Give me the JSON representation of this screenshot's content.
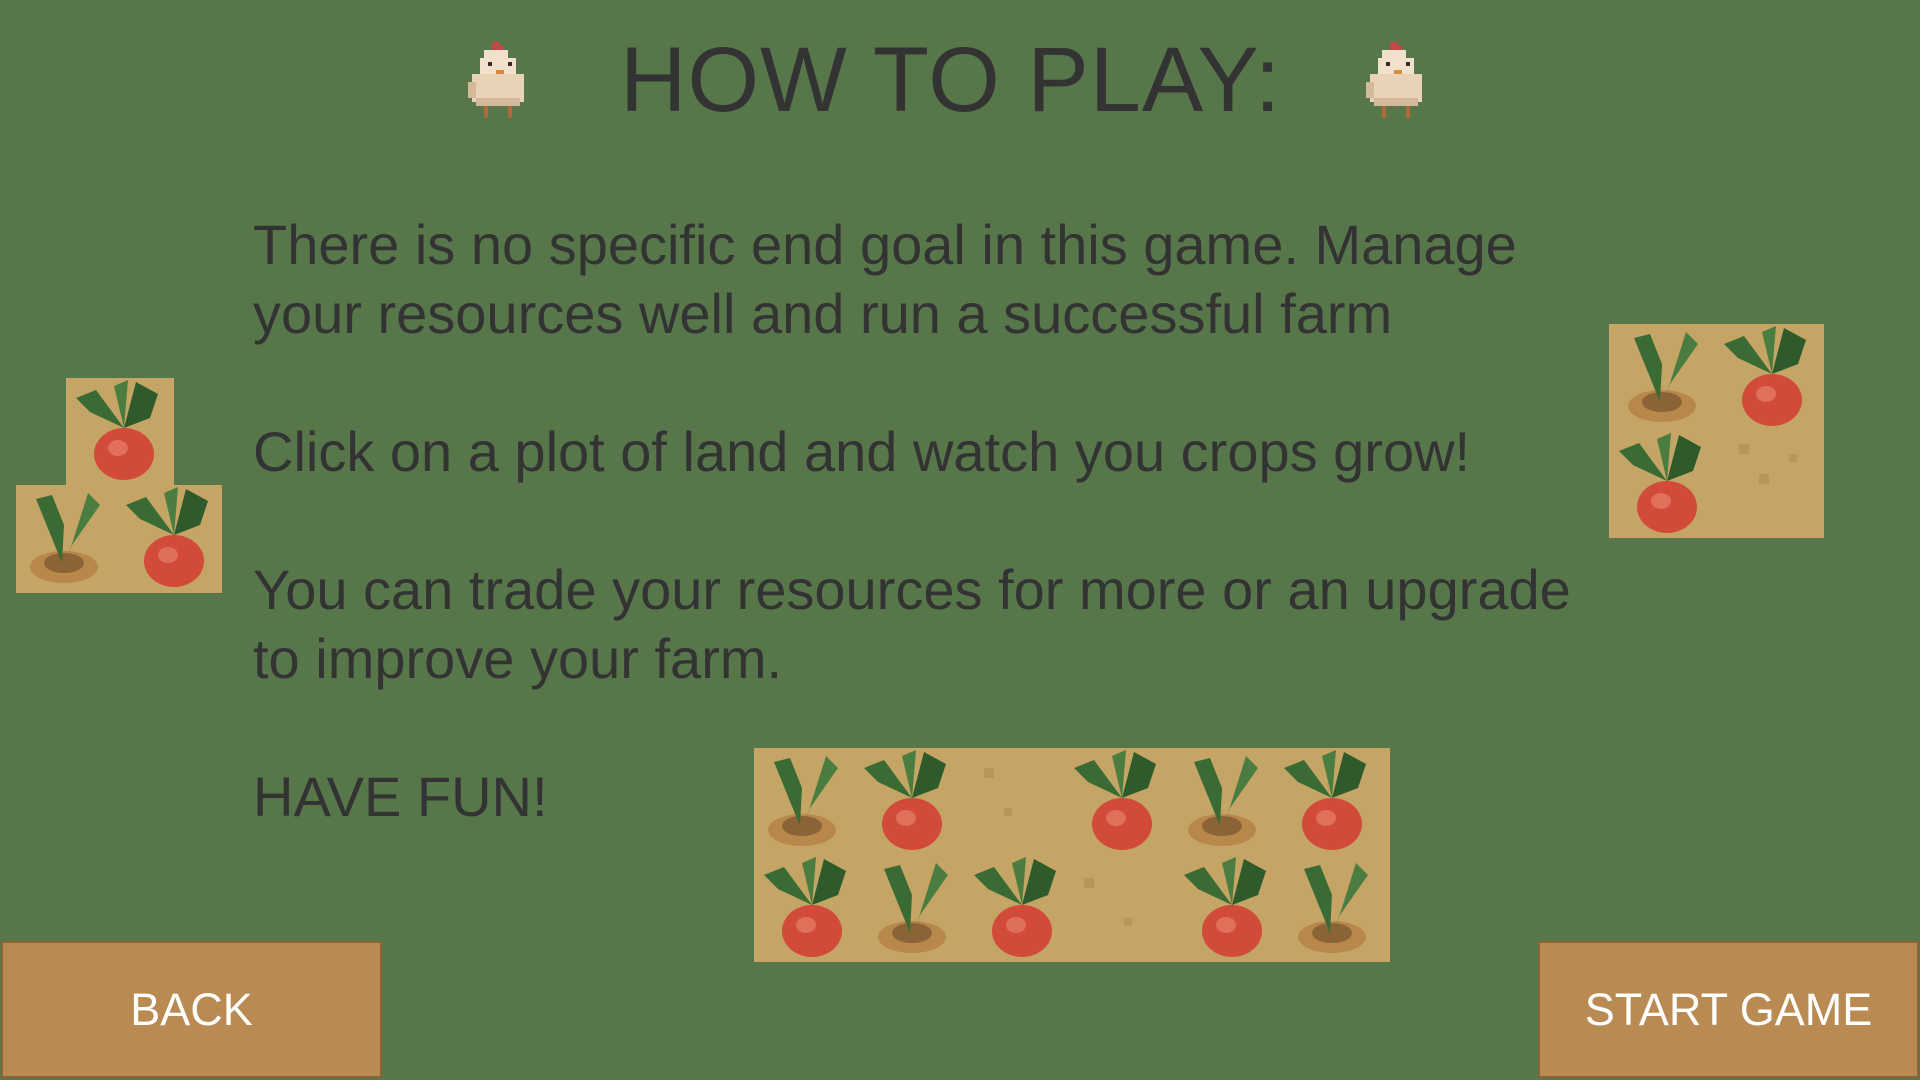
{
  "title": "HOW TO PLAY:",
  "instructions": {
    "goal_line1": "There is no specific end goal in this game. Manage",
    "goal_line2": "your resources well and run a successful farm",
    "click_line": "Click on a plot of land and watch you crops grow!",
    "trade_line1": "You can trade your resources for more or an upgrade",
    "trade_line2": "to improve your farm.",
    "fun_line": "HAVE FUN!"
  },
  "buttons": {
    "back_label": "BACK",
    "start_label": "START GAME"
  },
  "colors": {
    "background": "#57774a",
    "text": "#333333",
    "button": "#b98a52",
    "soil": "#c4a565",
    "leaf": "#3b6b34",
    "beet": "#d24a3a"
  },
  "icons": [
    "chicken-icon",
    "beet-crop-icon",
    "sprout-crop-icon"
  ]
}
